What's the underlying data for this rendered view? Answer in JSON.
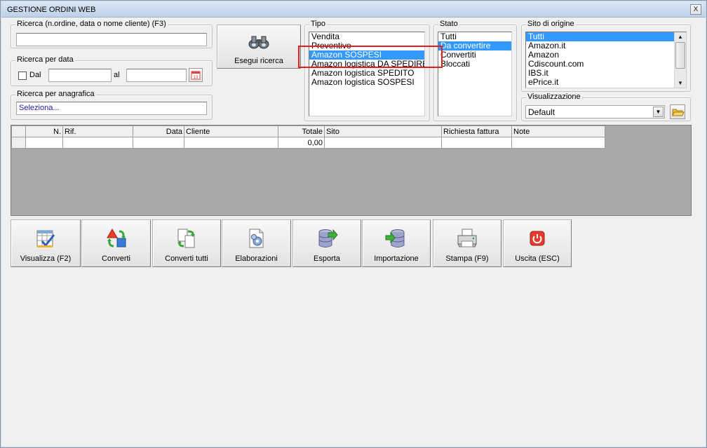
{
  "window": {
    "title": "GESTIONE ORDINI WEB",
    "close_label": "X"
  },
  "search": {
    "group_title": "Ricerca (n.ordine, data o nome cliente) (F3)",
    "value": "",
    "button_label": "Esegui ricerca"
  },
  "date_search": {
    "group_title": "Ricerca per data",
    "from_label": "Dal",
    "to_label": "al",
    "from_value": "",
    "to_value": ""
  },
  "registry_search": {
    "group_title": "Ricerca per anagrafica",
    "value": "Seleziona..."
  },
  "tipo": {
    "group_title": "Tipo",
    "items": [
      "Vendita",
      "Preventivo",
      "Amazon SOSPESI",
      "Amazon logistica DA SPEDIRE",
      "Amazon logistica SPEDITO",
      "Amazon logistica SOSPESI"
    ],
    "selected": "Amazon SOSPESI"
  },
  "stato": {
    "group_title": "Stato",
    "items": [
      "Tutti",
      "Da convertire",
      "Convertiti",
      "Bloccati"
    ],
    "selected": "Da convertire"
  },
  "sito": {
    "group_title": "Sito di origine",
    "items": [
      "Tutti",
      "Amazon.it",
      "Amazon",
      "Cdiscount.com",
      "IBS.it",
      "ePrice.it"
    ],
    "selected": "Tutti"
  },
  "visualizzazione": {
    "group_title": "Visualizzazione",
    "value": "Default"
  },
  "grid": {
    "columns": [
      "",
      "N.",
      "Rif.",
      "Data",
      "Cliente",
      "Totale",
      "Sito",
      "Richiesta fattura",
      "Note"
    ],
    "rows": [
      [
        "",
        "",
        "",
        "",
        "",
        "0,00",
        "",
        "",
        ""
      ]
    ]
  },
  "toolbar": {
    "visualizza": "Visualizza (F2)",
    "converti": "Converti",
    "converti_tutti": "Converti tutti",
    "elaborazioni": "Elaborazioni",
    "esporta": "Esporta",
    "importazione": "Importazione",
    "stampa": "Stampa (F9)",
    "uscita": "Uscita (ESC)"
  },
  "colors": {
    "selection": "#3399ff",
    "highlight": "#e0201c",
    "grid_bg": "#a9a9a9"
  }
}
